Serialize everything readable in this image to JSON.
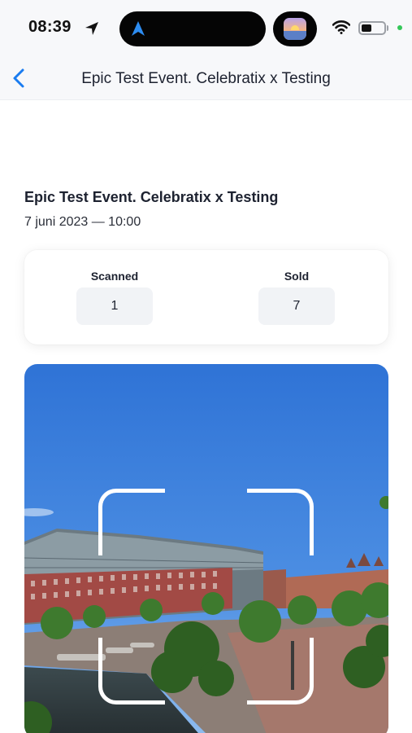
{
  "status_bar": {
    "time": "08:39",
    "battery_level": 0.45,
    "icons": [
      "location-arrow-icon",
      "navigation-icon",
      "app-thumbnail-icon",
      "wifi-icon",
      "battery-icon"
    ]
  },
  "nav": {
    "back_icon": "chevron-left-icon",
    "title": "Epic Test Event. Celebratix x Testing"
  },
  "event": {
    "title": "Epic Test Event. Celebratix x Testing",
    "date": "7 juni 2023 — 10:00"
  },
  "stats": {
    "scanned_label": "Scanned",
    "scanned_value": "1",
    "sold_label": "Sold",
    "sold_value": "7"
  },
  "camera": {
    "icon": "qr-scan-frame-icon"
  },
  "colors": {
    "accent": "#1a7cf0",
    "text": "#1d2230",
    "bar_background": "#f7f8fa",
    "stat_background": "#f1f3f6"
  }
}
